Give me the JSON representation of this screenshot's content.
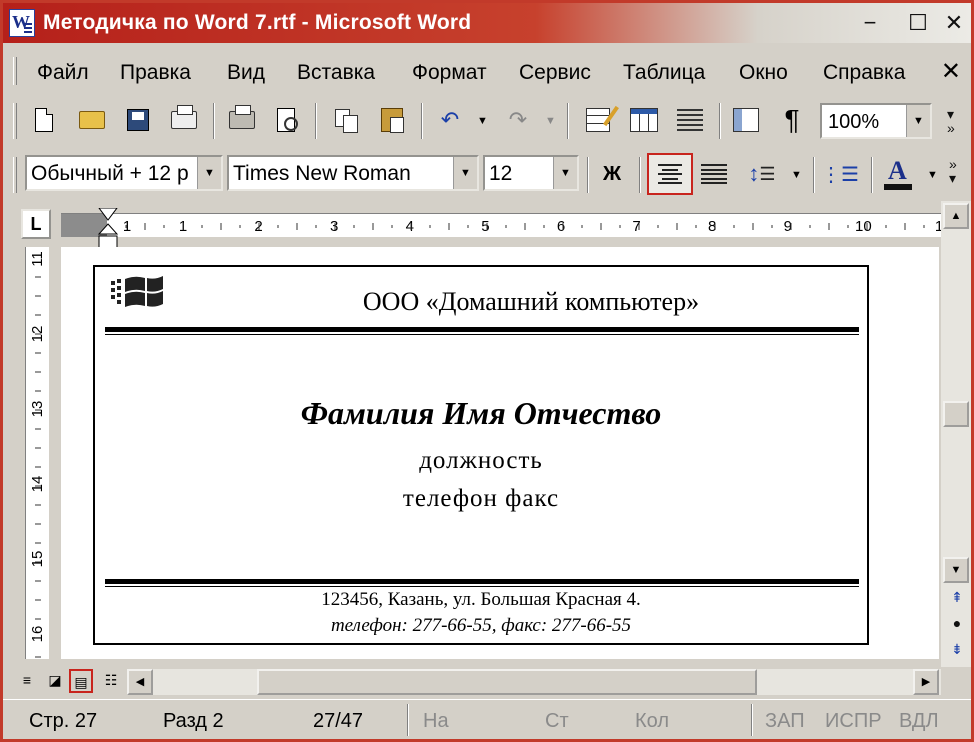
{
  "window": {
    "title": "Методичка по Word 7.rtf - Microsoft Word",
    "app_icon": "word-icon",
    "controls": {
      "minimize": "−",
      "maximize": "☐",
      "close": "✕"
    }
  },
  "menu": {
    "items": [
      "Файл",
      "Правка",
      "Вид",
      "Вставка",
      "Формат",
      "Сервис",
      "Таблица",
      "Окно",
      "Справка"
    ],
    "close_glyph": "✕"
  },
  "standard_toolbar": {
    "buttons": [
      "new-document-icon",
      "open-icon",
      "save-icon",
      "mail-recipient-icon",
      "print-icon",
      "print-preview-icon",
      "copy-icon",
      "paste-icon",
      "undo-icon",
      "redo-icon",
      "tables-and-borders-icon",
      "insert-table-icon",
      "columns-icon",
      "document-map-icon",
      "show-hide-icon"
    ],
    "show_hide_glyph": "¶",
    "zoom": "100%"
  },
  "formatting_toolbar": {
    "style": "Обычный + 12 р",
    "font": "Times New Roman",
    "size": "12",
    "bold_label": "Ж",
    "active_button": "align-center",
    "font_color": "#1b2f8a"
  },
  "ruler": {
    "tab_selector": "L",
    "h_numbers": [
      "1",
      "1",
      "2",
      "3",
      "4",
      "5",
      "6",
      "7",
      "8",
      "9",
      "10",
      "1"
    ],
    "v_numbers": [
      "11",
      "12",
      "13",
      "14",
      "15",
      "16"
    ]
  },
  "document": {
    "company": "ООО «Домашний компьютер»",
    "person": "Фамилия Имя Отчество",
    "position": "должность",
    "phone_fax": "телефон факс",
    "address": "123456, Казань, ул. Большая Красная 4.",
    "contacts": "телефон: 277-66-55, факс: 277-66-55"
  },
  "view_buttons": [
    "normal-view-icon",
    "web-layout-icon",
    "print-layout-icon",
    "outline-view-icon"
  ],
  "active_view": "print-layout-icon",
  "statusbar": {
    "page": "Стр.  27",
    "section": "Разд  2",
    "pages": "27/47",
    "at": "На",
    "line": "Ст",
    "col": "Кол",
    "rec": "ЗАП",
    "trk": "ИСПР",
    "ext": "ВДЛ"
  },
  "colors": {
    "title_bar": "#b5201a",
    "highlight_border": "#c8241d",
    "chrome": "#d4d0c8"
  }
}
